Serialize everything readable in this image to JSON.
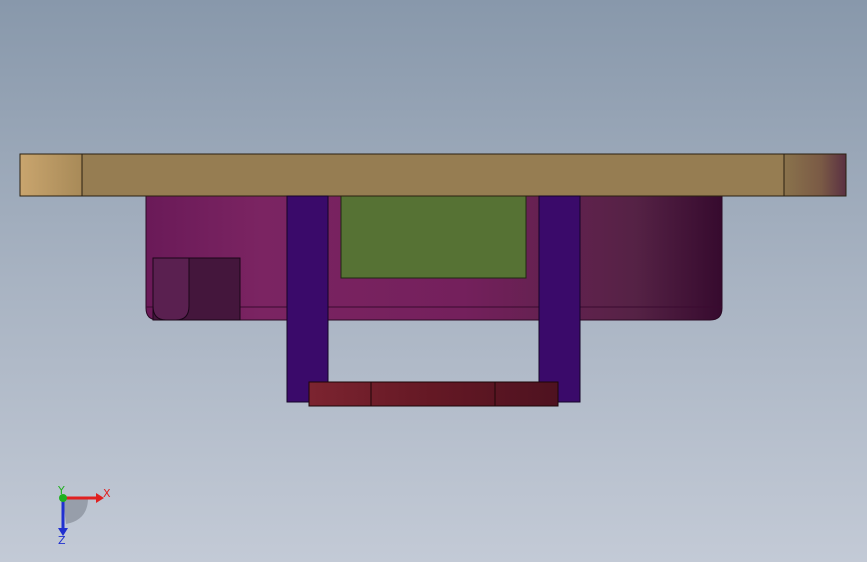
{
  "viewport": {
    "background_top": "#8898ab",
    "background_bottom": "#c3cad6"
  },
  "model": {
    "parts": [
      {
        "name": "top-plate",
        "color": "#967d52"
      },
      {
        "name": "housing-body",
        "color": "#74205c"
      },
      {
        "name": "inner-block",
        "color": "#567234"
      },
      {
        "name": "left-post",
        "color": "#3a0a6a"
      },
      {
        "name": "right-post",
        "color": "#3a0a6a"
      },
      {
        "name": "bottom-bar",
        "color": "#651a25"
      },
      {
        "name": "side-slot",
        "color": "#44163c"
      }
    ]
  },
  "triad": {
    "x_label": "X",
    "y_label": "Y",
    "z_label": "Z",
    "x_color": "#e02020",
    "y_color": "#20b020",
    "z_color": "#2030d0"
  }
}
